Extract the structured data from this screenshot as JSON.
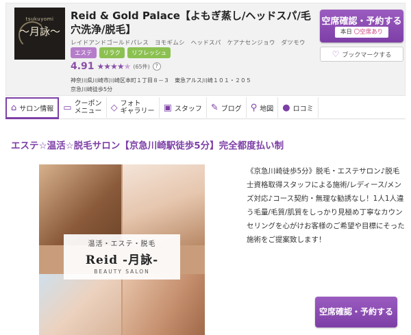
{
  "header": {
    "logo": {
      "sub": "tsukuyomi",
      "main": "～月詠～"
    },
    "salon_name": "Reid & Gold Palace【よもぎ蒸し/ヘッドスパ/毛穴洗浄/脱毛】",
    "salon_kana": "レイドアンドゴールドパレス　ヨモギムシ　ヘッドスパ　ケアナセンジョウ　ダツモウ",
    "tags": [
      "エステ",
      "リラク",
      "リフレッシュ"
    ],
    "rating": {
      "score": "4.91",
      "stars": "★★★★",
      "half_star": "★",
      "count": "(65件)",
      "help": "?"
    },
    "address_line1": "神奈川県川崎市川崎区本町１丁目８－３　東急アルス川崎１０１・２０５",
    "address_line2": "京急川崎徒歩5分",
    "reserve_label": "空席確認・予約する",
    "today_label": "本日",
    "avail_label": "〇空席あり",
    "bookmark_label": "ブックマークする",
    "colors": {
      "accent": "#7d3fa6",
      "tag_purple": "#b57dc9",
      "tag_green": "#8cc152"
    }
  },
  "tabs": [
    {
      "icon": "house-icon",
      "label": "サロン情報"
    },
    {
      "icon": "coupon-icon",
      "label": "クーポン\nメニュー"
    },
    {
      "icon": "photo-icon",
      "label": "フォト\nギャラリー"
    },
    {
      "icon": "staff-icon",
      "label": "スタッフ"
    },
    {
      "icon": "pen-icon",
      "label": "ブログ"
    },
    {
      "icon": "map-pin-icon",
      "label": "地図"
    },
    {
      "icon": "chat-icon",
      "label": "ロコミ"
    }
  ],
  "main": {
    "catch_copy": "エステ☆温活☆脱毛サロン【京急川崎駅徒歩5分】完全都度払い制",
    "photo": {
      "line1": "温活・エステ・脱毛",
      "line2": "Reid -月詠-",
      "line3": "BEAUTY SALON"
    },
    "description": "《京急川崎徒歩5分》脱毛・エステサロン♪脱毛士資格取得スタッフによる施術/レディース/メンズ対応♪コース契約・無理な勧誘なし！1人1人違う毛量/毛質/肌質をしっかり見極め丁寧なカウンセリングを心がけお客様のご希望や目標にそった施術をご提案致します！",
    "reserve_label": "空席確認・予約する"
  }
}
